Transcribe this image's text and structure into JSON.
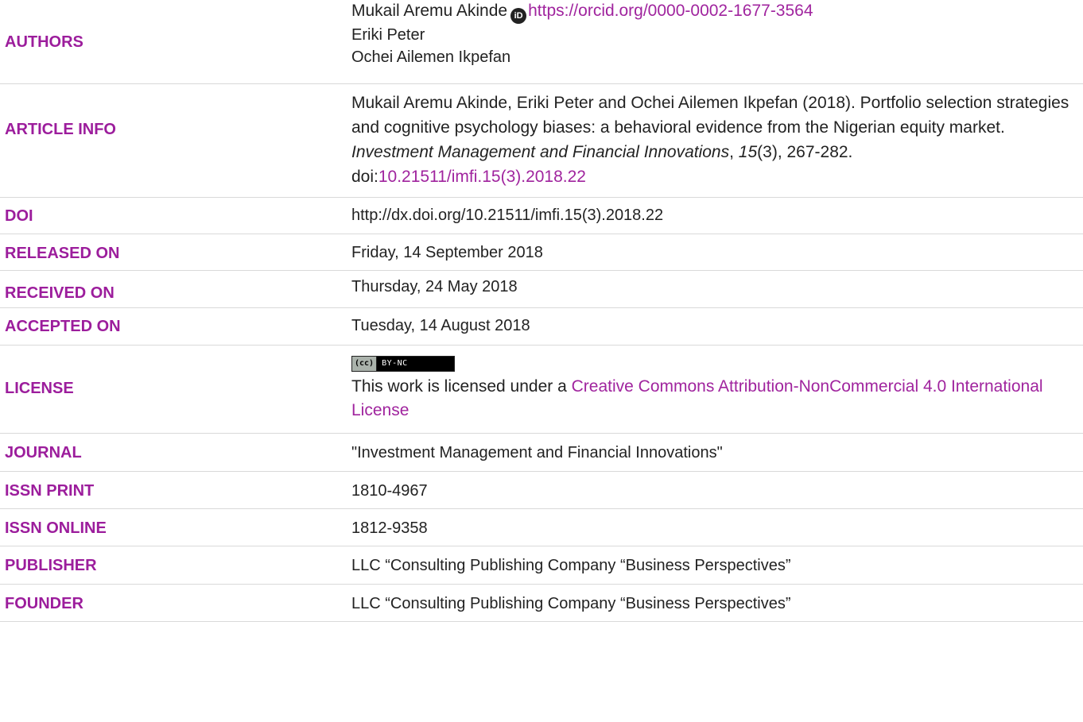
{
  "authors": {
    "label": "AUTHORS",
    "author1": "Mukail Aremu Akinde",
    "orcid_url": "https://orcid.org/0000-0002-1677-3564",
    "orcid_icon": "orcid-icon",
    "author2": "Eriki Peter",
    "author3": "Ochei Ailemen Ikpefan"
  },
  "article_info": {
    "label": "ARTICLE INFO",
    "citation_text": "Mukail Aremu Akinde, Eriki Peter and Ochei Ailemen Ikpefan (2018). Portfolio selection strategies and cognitive psychology biases: a behavioral evidence from the Nigerian equity market. ",
    "journal_italic": "Investment Management and Financial Innovations",
    "comma": ", ",
    "volume_italic": "15",
    "pages": "(3), 267-282. doi:",
    "doi_link": "10.21511/imfi.15(3).2018.22"
  },
  "doi": {
    "label": "DOI",
    "value": "http://dx.doi.org/10.21511/imfi.15(3).2018.22"
  },
  "released_on": {
    "label": "RELEASED ON",
    "value": "Friday, 14 September 2018"
  },
  "received_on": {
    "label": "RECEIVED ON",
    "value": "Thursday, 24 May 2018"
  },
  "accepted_on": {
    "label": "ACCEPTED ON",
    "value": "Tuesday, 14 August 2018"
  },
  "license": {
    "label": "LICENSE",
    "badge_left": "(cc)",
    "badge_right": "BY-NC",
    "text_prefix": "This work is licensed under a ",
    "link_text": "Creative Commons Attribution-NonCommercial 4.0 International License"
  },
  "journal": {
    "label": "JOURNAL",
    "value": "\"Investment Management and Financial Innovations\""
  },
  "issn_print": {
    "label": "ISSN PRINT",
    "value": "1810-4967"
  },
  "issn_online": {
    "label": "ISSN ONLINE",
    "value": "1812-9358"
  },
  "publisher": {
    "label": "PUBLISHER",
    "value": "LLC “Consulting Publishing Company “Business Perspectives”"
  },
  "founder": {
    "label": "FOUNDER",
    "value": "LLC “Consulting Publishing Company “Business Perspectives”"
  },
  "colors": {
    "label": "#9c1d9c",
    "link": "#a0249e",
    "text": "#222222",
    "divider": "#d9d9d9"
  }
}
